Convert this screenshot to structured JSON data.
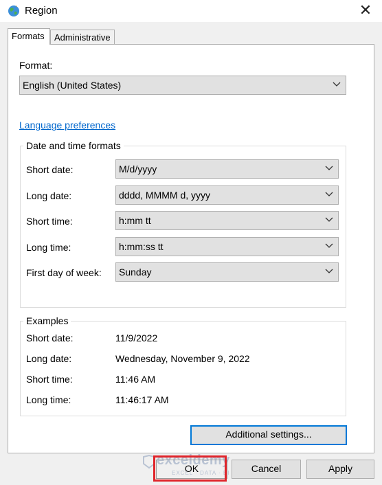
{
  "window": {
    "title": "Region",
    "close_glyph": "✕"
  },
  "tabs": [
    {
      "label": "Formats",
      "active": true
    },
    {
      "label": "Administrative",
      "active": false
    }
  ],
  "format": {
    "label": "Format:",
    "value": "English (United States)"
  },
  "language_link": "Language preferences",
  "date_time_formats": {
    "title": "Date and time formats",
    "rows": [
      {
        "label": "Short date:",
        "value": "M/d/yyyy"
      },
      {
        "label": "Long date:",
        "value": "dddd, MMMM d, yyyy"
      },
      {
        "label": "Short time:",
        "value": "h:mm tt"
      },
      {
        "label": "Long time:",
        "value": "h:mm:ss tt"
      },
      {
        "label": "First day of week:",
        "value": "Sunday"
      }
    ]
  },
  "examples": {
    "title": "Examples",
    "rows": [
      {
        "label": "Short date:",
        "value": "11/9/2022"
      },
      {
        "label": "Long date:",
        "value": "Wednesday, November 9, 2022"
      },
      {
        "label": "Short time:",
        "value": "11:46 AM"
      },
      {
        "label": "Long time:",
        "value": "11:46:17 AM"
      }
    ]
  },
  "buttons": {
    "additional_settings": "Additional settings...",
    "ok": "OK",
    "cancel": "Cancel",
    "apply": "Apply"
  },
  "watermark": {
    "name": "exceldemy",
    "tagline": "EXCEL · DATA · BI"
  },
  "colors": {
    "link": "#0066cc",
    "focus": "#0078d7",
    "highlight": "#e0242a"
  }
}
